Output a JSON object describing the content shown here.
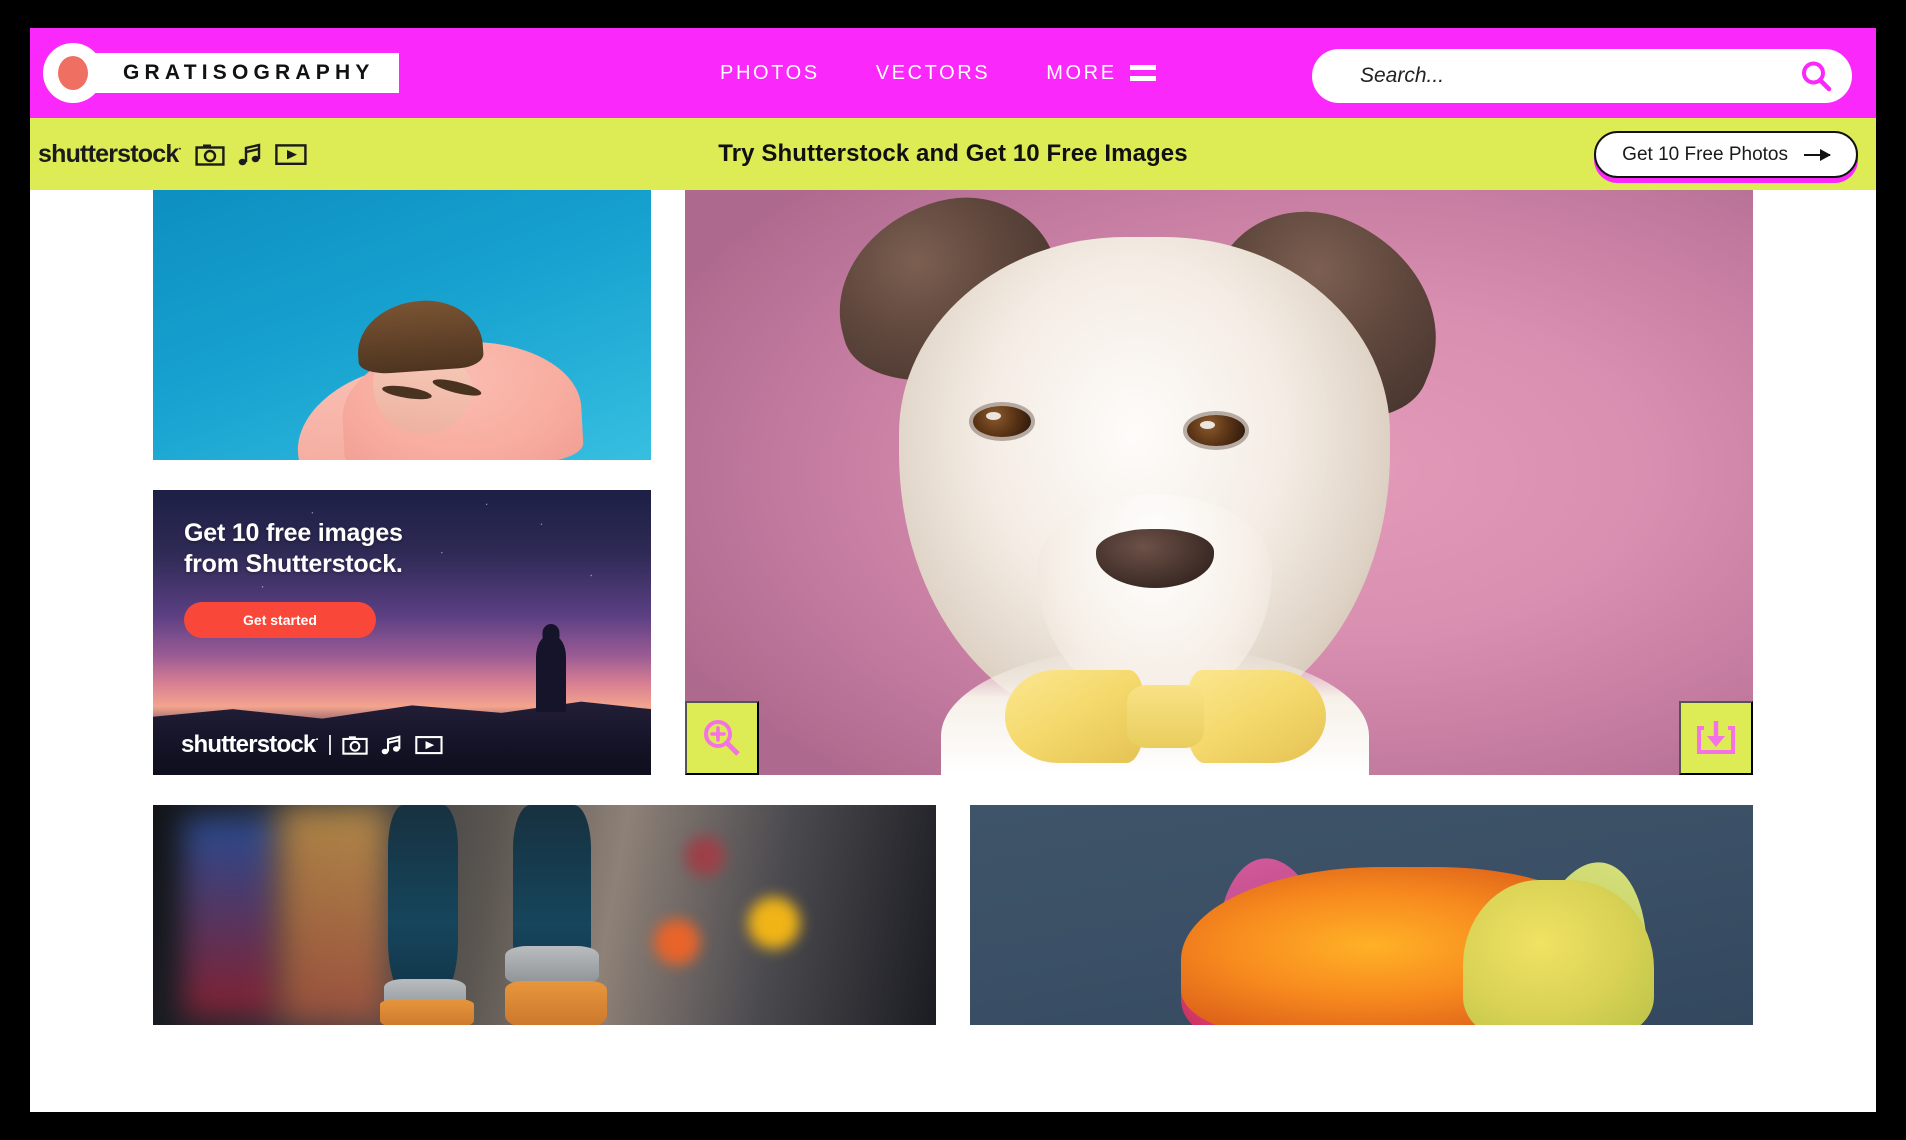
{
  "site": {
    "brand_name": "GRATISOGRAPHY",
    "colors": {
      "magenta": "#FB28FB",
      "yellow_green": "#DDEB55",
      "logo_dot": "#EF6F62",
      "promo_cta_shadow": "#FB28FB",
      "ad_button_red": "#F9483A"
    }
  },
  "header": {
    "nav": [
      {
        "label": "PHOTOS",
        "icon": ""
      },
      {
        "label": "VECTORS",
        "icon": ""
      },
      {
        "label": "MORE",
        "icon": "hamburger-icon"
      }
    ],
    "search": {
      "placeholder": "Search...",
      "value": "",
      "icon": "search-icon"
    }
  },
  "promo_bar": {
    "brand": "shutterstock",
    "brand_tm": "·",
    "media_icons": [
      "camera-icon",
      "music-note-icon",
      "video-play-icon"
    ],
    "headline": "Try Shutterstock and Get 10 Free Images",
    "cta_label": "Get 10 Free Photos",
    "cta_icon": "arrow-right-icon"
  },
  "gallery": {
    "tiles": [
      {
        "name": "photo-tile-man-blue",
        "alt": "Man with messy hair in pink shirt against blue sky background"
      },
      {
        "name": "ad-tile-shutterstock",
        "alt": "Hiker silhouette under purple sunset sky",
        "ad": {
          "title_line1": "Get 10 free images",
          "title_line2": "from Shutterstock.",
          "button_label": "Get started",
          "brand": "shutterstock",
          "brand_tm": "·",
          "media_icons": [
            "camera-icon",
            "music-note-icon",
            "video-play-icon"
          ]
        }
      },
      {
        "name": "photo-tile-dog",
        "alt": "Terrier dog wearing a yellow bow tie on a pink background",
        "overlay": {
          "zoom_icon": "zoom-in-icon",
          "download_icon": "download-icon"
        }
      },
      {
        "name": "photo-tile-boots",
        "alt": "Close-up of person wearing orange boots on a colorful street"
      },
      {
        "name": "photo-tile-cat",
        "alt": "Cat wearing a colorful knitted rainbow hat against blue sky"
      }
    ]
  }
}
